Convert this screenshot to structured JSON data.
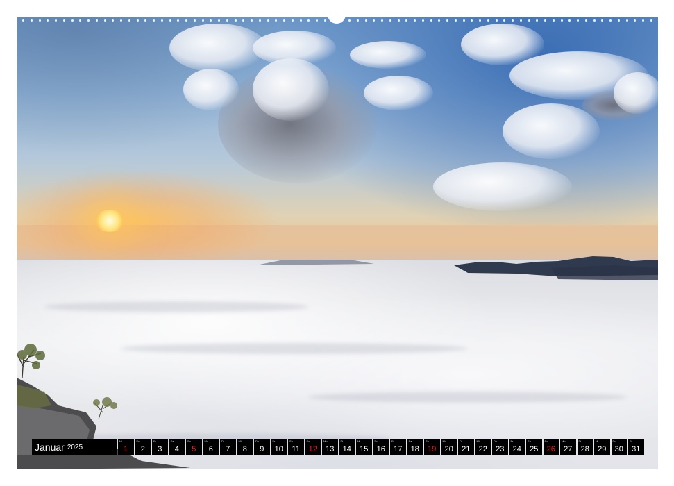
{
  "calendar": {
    "month": "Januar",
    "year": "2025",
    "days": [
      {
        "wd": "Mi",
        "num": "1",
        "red": true
      },
      {
        "wd": "Do",
        "num": "2",
        "red": false
      },
      {
        "wd": "Fr",
        "num": "3",
        "red": false
      },
      {
        "wd": "Sa",
        "num": "4",
        "red": false
      },
      {
        "wd": "So",
        "num": "5",
        "red": true
      },
      {
        "wd": "Mo",
        "num": "6",
        "red": false
      },
      {
        "wd": "Di",
        "num": "7",
        "red": false
      },
      {
        "wd": "Mi",
        "num": "8",
        "red": false
      },
      {
        "wd": "Do",
        "num": "9",
        "red": false
      },
      {
        "wd": "Fr",
        "num": "10",
        "red": false
      },
      {
        "wd": "Sa",
        "num": "11",
        "red": false
      },
      {
        "wd": "So",
        "num": "12",
        "red": true
      },
      {
        "wd": "Mo",
        "num": "13",
        "red": false
      },
      {
        "wd": "Di",
        "num": "14",
        "red": false
      },
      {
        "wd": "Mi",
        "num": "15",
        "red": false
      },
      {
        "wd": "Do",
        "num": "16",
        "red": false
      },
      {
        "wd": "Fr",
        "num": "17",
        "red": false
      },
      {
        "wd": "Sa",
        "num": "18",
        "red": false
      },
      {
        "wd": "So",
        "num": "19",
        "red": true
      },
      {
        "wd": "Mo",
        "num": "20",
        "red": false
      },
      {
        "wd": "Di",
        "num": "21",
        "red": false
      },
      {
        "wd": "Mi",
        "num": "22",
        "red": false
      },
      {
        "wd": "Do",
        "num": "23",
        "red": false
      },
      {
        "wd": "Fr",
        "num": "24",
        "red": false
      },
      {
        "wd": "Sa",
        "num": "25",
        "red": false
      },
      {
        "wd": "So",
        "num": "26",
        "red": true
      },
      {
        "wd": "Mo",
        "num": "27",
        "red": false
      },
      {
        "wd": "Di",
        "num": "28",
        "red": false
      },
      {
        "wd": "Mi",
        "num": "29",
        "red": false
      },
      {
        "wd": "Do",
        "num": "30",
        "red": false
      },
      {
        "wd": "Fr",
        "num": "31",
        "red": false
      }
    ]
  },
  "colors": {
    "holiday_red": "#e02020",
    "cell_bg": "#000000",
    "text": "#ffffff"
  }
}
